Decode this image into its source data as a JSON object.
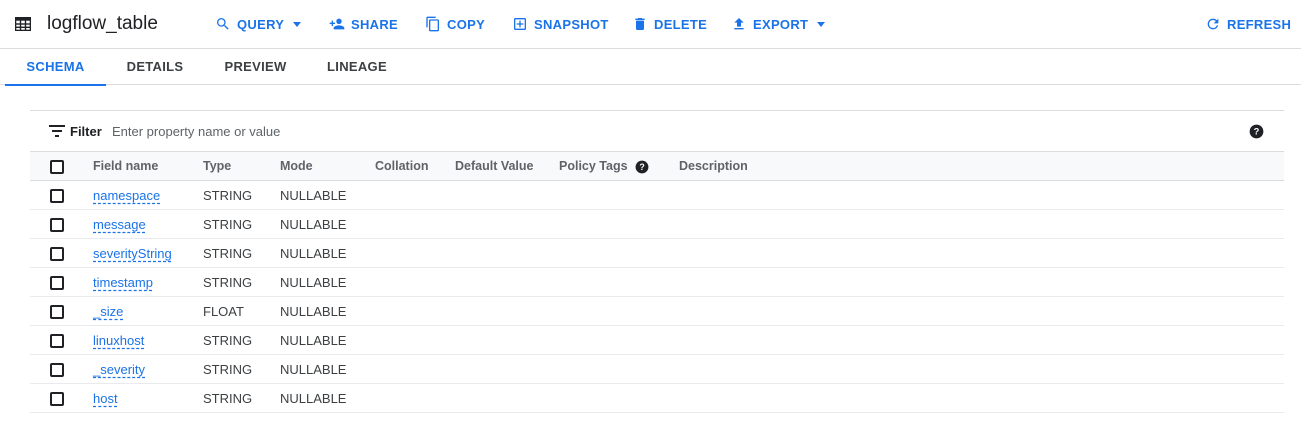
{
  "toolbar": {
    "title": "logflow_table",
    "icon": "table-icon",
    "buttons": [
      {
        "label": "QUERY",
        "icon": "search-icon",
        "dropdown": true
      },
      {
        "label": "SHARE",
        "icon": "person-add-icon",
        "dropdown": false
      },
      {
        "label": "COPY",
        "icon": "copy-icon",
        "dropdown": false
      },
      {
        "label": "SNAPSHOT",
        "icon": "snapshot-icon",
        "dropdown": false
      },
      {
        "label": "DELETE",
        "icon": "trash-icon",
        "dropdown": false
      },
      {
        "label": "EXPORT",
        "icon": "upload-icon",
        "dropdown": true
      }
    ],
    "refresh_label": "REFRESH",
    "accent_color": "#1a73e8"
  },
  "tabs": [
    {
      "label": "SCHEMA",
      "active": true
    },
    {
      "label": "DETAILS",
      "active": false
    },
    {
      "label": "PREVIEW",
      "active": false
    },
    {
      "label": "LINEAGE",
      "active": false
    }
  ],
  "filter": {
    "label": "Filter",
    "placeholder": "Enter property name or value"
  },
  "schema": {
    "columns": [
      "Field name",
      "Type",
      "Mode",
      "Collation",
      "Default Value",
      "Policy Tags",
      "Description"
    ],
    "rows": [
      {
        "field": "namespace",
        "type": "STRING",
        "mode": "NULLABLE"
      },
      {
        "field": "message",
        "type": "STRING",
        "mode": "NULLABLE"
      },
      {
        "field": "severityString",
        "type": "STRING",
        "mode": "NULLABLE"
      },
      {
        "field": "timestamp",
        "type": "STRING",
        "mode": "NULLABLE"
      },
      {
        "field": "_size",
        "type": "FLOAT",
        "mode": "NULLABLE"
      },
      {
        "field": "linuxhost",
        "type": "STRING",
        "mode": "NULLABLE"
      },
      {
        "field": "_severity",
        "type": "STRING",
        "mode": "NULLABLE"
      },
      {
        "field": "host",
        "type": "STRING",
        "mode": "NULLABLE"
      }
    ]
  }
}
